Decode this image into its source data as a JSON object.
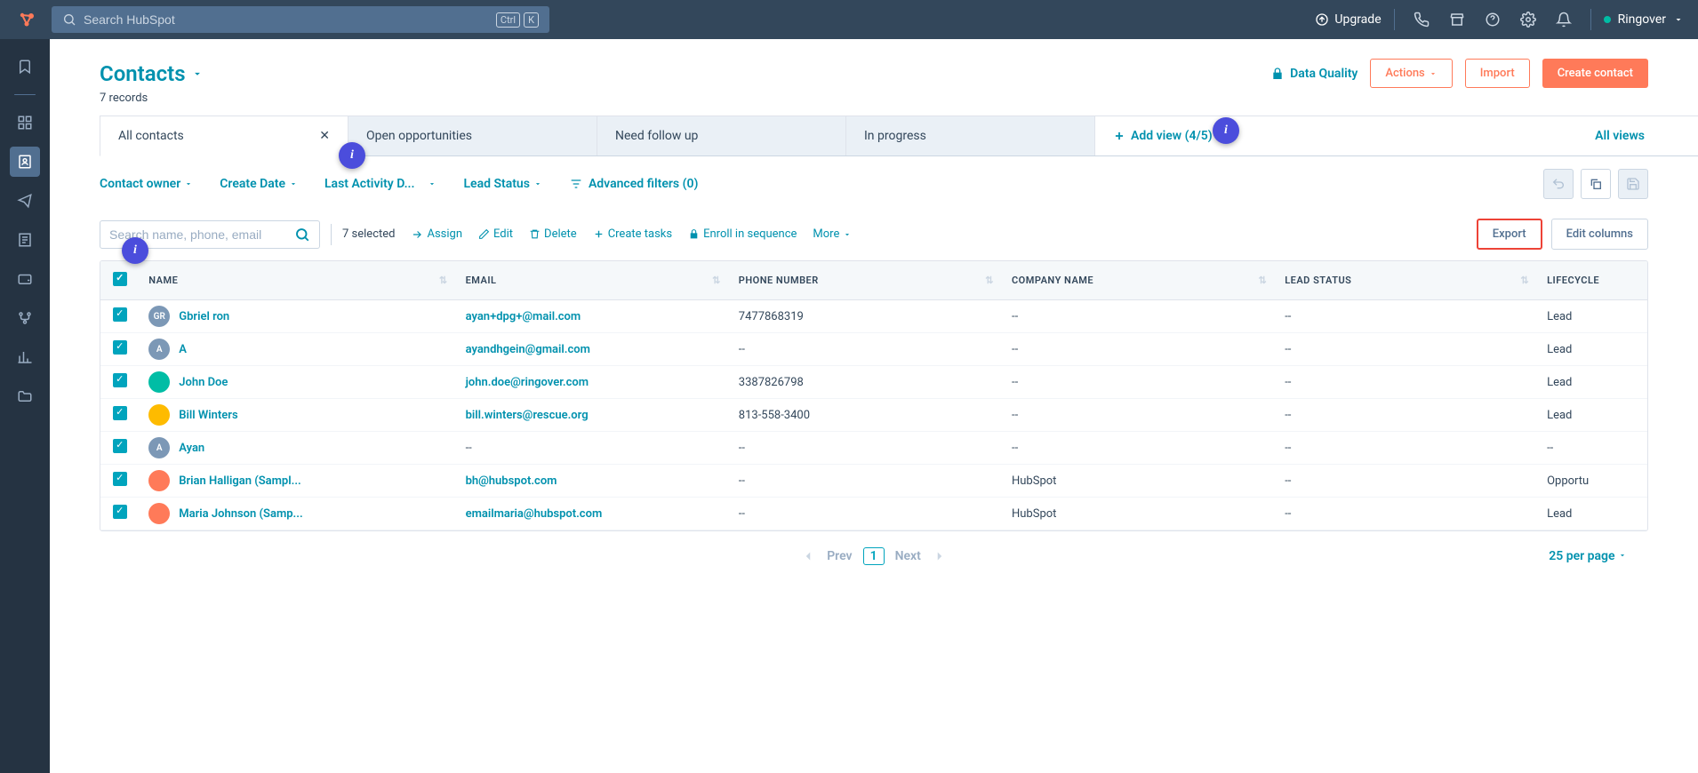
{
  "topnav": {
    "search_placeholder": "Search HubSpot",
    "kbd1": "Ctrl",
    "kbd2": "K",
    "upgrade": "Upgrade",
    "account_name": "Ringover"
  },
  "header": {
    "title": "Contacts",
    "records": "7 records",
    "data_quality": "Data Quality",
    "actions": "Actions",
    "import": "Import",
    "create": "Create contact"
  },
  "tabs": [
    {
      "label": "All contacts",
      "active": true,
      "closable": true
    },
    {
      "label": "Open opportunities",
      "active": false
    },
    {
      "label": "Need follow up",
      "active": false
    },
    {
      "label": "In progress",
      "active": false
    }
  ],
  "add_view": "Add view (4/5)",
  "all_views": "All views",
  "filters": {
    "owner": "Contact owner",
    "create_date": "Create Date",
    "last_activity": "Last Activity D...",
    "lead_status": "Lead Status",
    "advanced": "Advanced filters (0)"
  },
  "search": {
    "placeholder": "Search name, phone, email"
  },
  "bulk": {
    "selected": "7 selected",
    "assign": "Assign",
    "edit": "Edit",
    "delete": "Delete",
    "create_tasks": "Create tasks",
    "enroll": "Enroll in sequence",
    "more": "More"
  },
  "export": "Export",
  "edit_columns": "Edit columns",
  "columns": {
    "name": "NAME",
    "email": "EMAIL",
    "phone": "PHONE NUMBER",
    "company": "COMPANY NAME",
    "lead_status": "LEAD STATUS",
    "lifecycle": "LIFECYCLE"
  },
  "rows": [
    {
      "avatar_bg": "#7c98b6",
      "avatar_text": "GR",
      "name": "Gbriel ron",
      "email": "ayan+dpg+@mail.com",
      "phone": "7477868319",
      "company": "--",
      "lead_status": "--",
      "lifecycle": "Lead"
    },
    {
      "avatar_bg": "#7c98b6",
      "avatar_text": "A",
      "name": "A",
      "email": "ayandhgein@gmail.com",
      "phone": "--",
      "company": "--",
      "lead_status": "--",
      "lifecycle": "Lead"
    },
    {
      "avatar_bg": "#00bda5",
      "avatar_text": "",
      "name": "John Doe",
      "email": "john.doe@ringover.com",
      "phone": "3387826798",
      "company": "--",
      "lead_status": "--",
      "lifecycle": "Lead"
    },
    {
      "avatar_bg": "#febb00",
      "avatar_text": "",
      "name": "Bill Winters",
      "email": "bill.winters@rescue.org",
      "phone": "813-558-3400",
      "company": "--",
      "lead_status": "--",
      "lifecycle": "Lead"
    },
    {
      "avatar_bg": "#7c98b6",
      "avatar_text": "A",
      "name": "Ayan",
      "email": "--",
      "phone": "--",
      "company": "--",
      "lead_status": "--",
      "lifecycle": "--"
    },
    {
      "avatar_bg": "#ff7a59",
      "avatar_text": "",
      "name": "Brian Halligan (Sampl...",
      "email": "bh@hubspot.com",
      "phone": "--",
      "company": "HubSpot",
      "lead_status": "--",
      "lifecycle": "Opportu"
    },
    {
      "avatar_bg": "#ff7a59",
      "avatar_text": "",
      "name": "Maria Johnson (Samp...",
      "email": "emailmaria@hubspot.com",
      "phone": "--",
      "company": "HubSpot",
      "lead_status": "--",
      "lifecycle": "Lead"
    }
  ],
  "pagination": {
    "prev": "Prev",
    "page": "1",
    "next": "Next",
    "per_page": "25 per page"
  },
  "info_marker": "i"
}
